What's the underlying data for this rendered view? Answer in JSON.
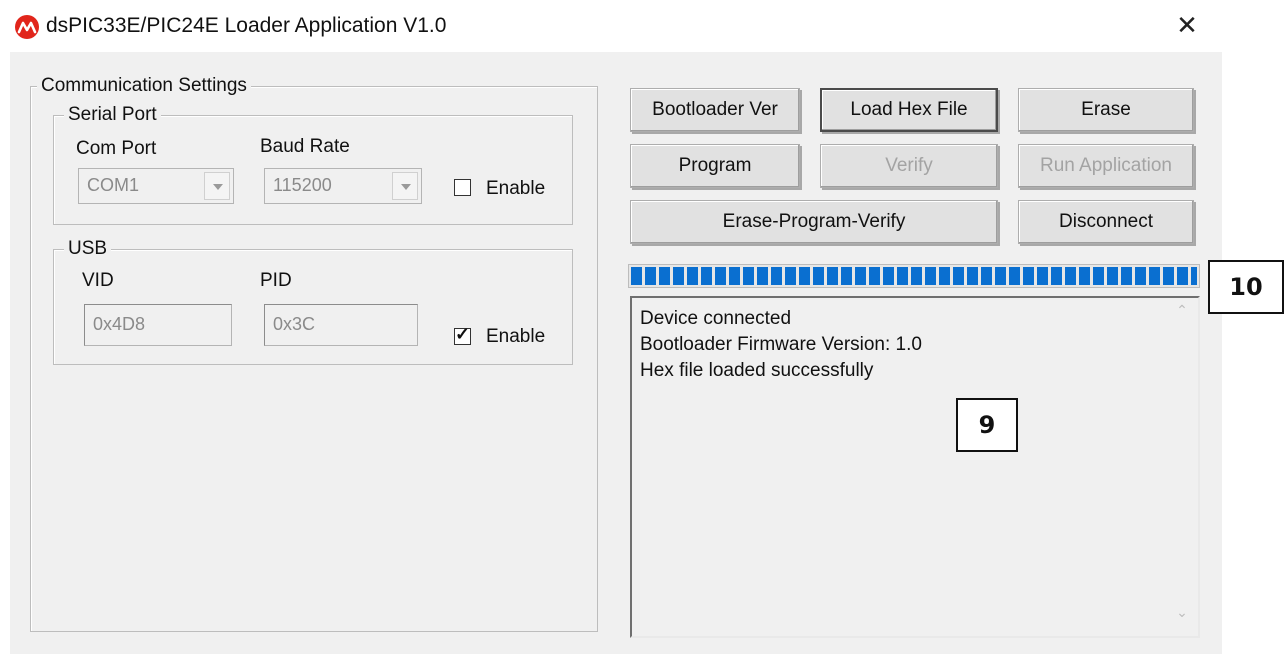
{
  "window": {
    "title": "dsPIC33E/PIC24E Loader Application V1.0",
    "icon": "microchip-logo-icon",
    "close_glyph": "✕"
  },
  "communication": {
    "title": "Communication Settings",
    "serial": {
      "title": "Serial Port",
      "com_port_label": "Com Port",
      "com_port_value": "COM1",
      "baud_rate_label": "Baud Rate",
      "baud_rate_value": "115200",
      "enable_label": "Enable",
      "enabled": false
    },
    "usb": {
      "title": "USB",
      "vid_label": "VID",
      "vid_value": "0x4D8",
      "pid_label": "PID",
      "pid_value": "0x3C",
      "enable_label": "Enable",
      "enabled": true,
      "check_glyph": "✓"
    }
  },
  "buttons": {
    "bootloader_ver": "Bootloader Ver",
    "load_hex_file": "Load Hex File",
    "erase": "Erase",
    "program": "Program",
    "verify": "Verify",
    "run_application": "Run Application",
    "erase_program_verify": "Erase-Program-Verify",
    "disconnect": "Disconnect"
  },
  "progress": {
    "value_percent": 100,
    "color": "#0a6fd0"
  },
  "log": {
    "lines": [
      "Device connected",
      "Bootloader Firmware Version: 1.0",
      "Hex file loaded successfully"
    ],
    "scroll_up_glyph": "⌃",
    "scroll_down_glyph": "⌄"
  },
  "callouts": {
    "progress_callout": "10",
    "log_callout": "9"
  }
}
